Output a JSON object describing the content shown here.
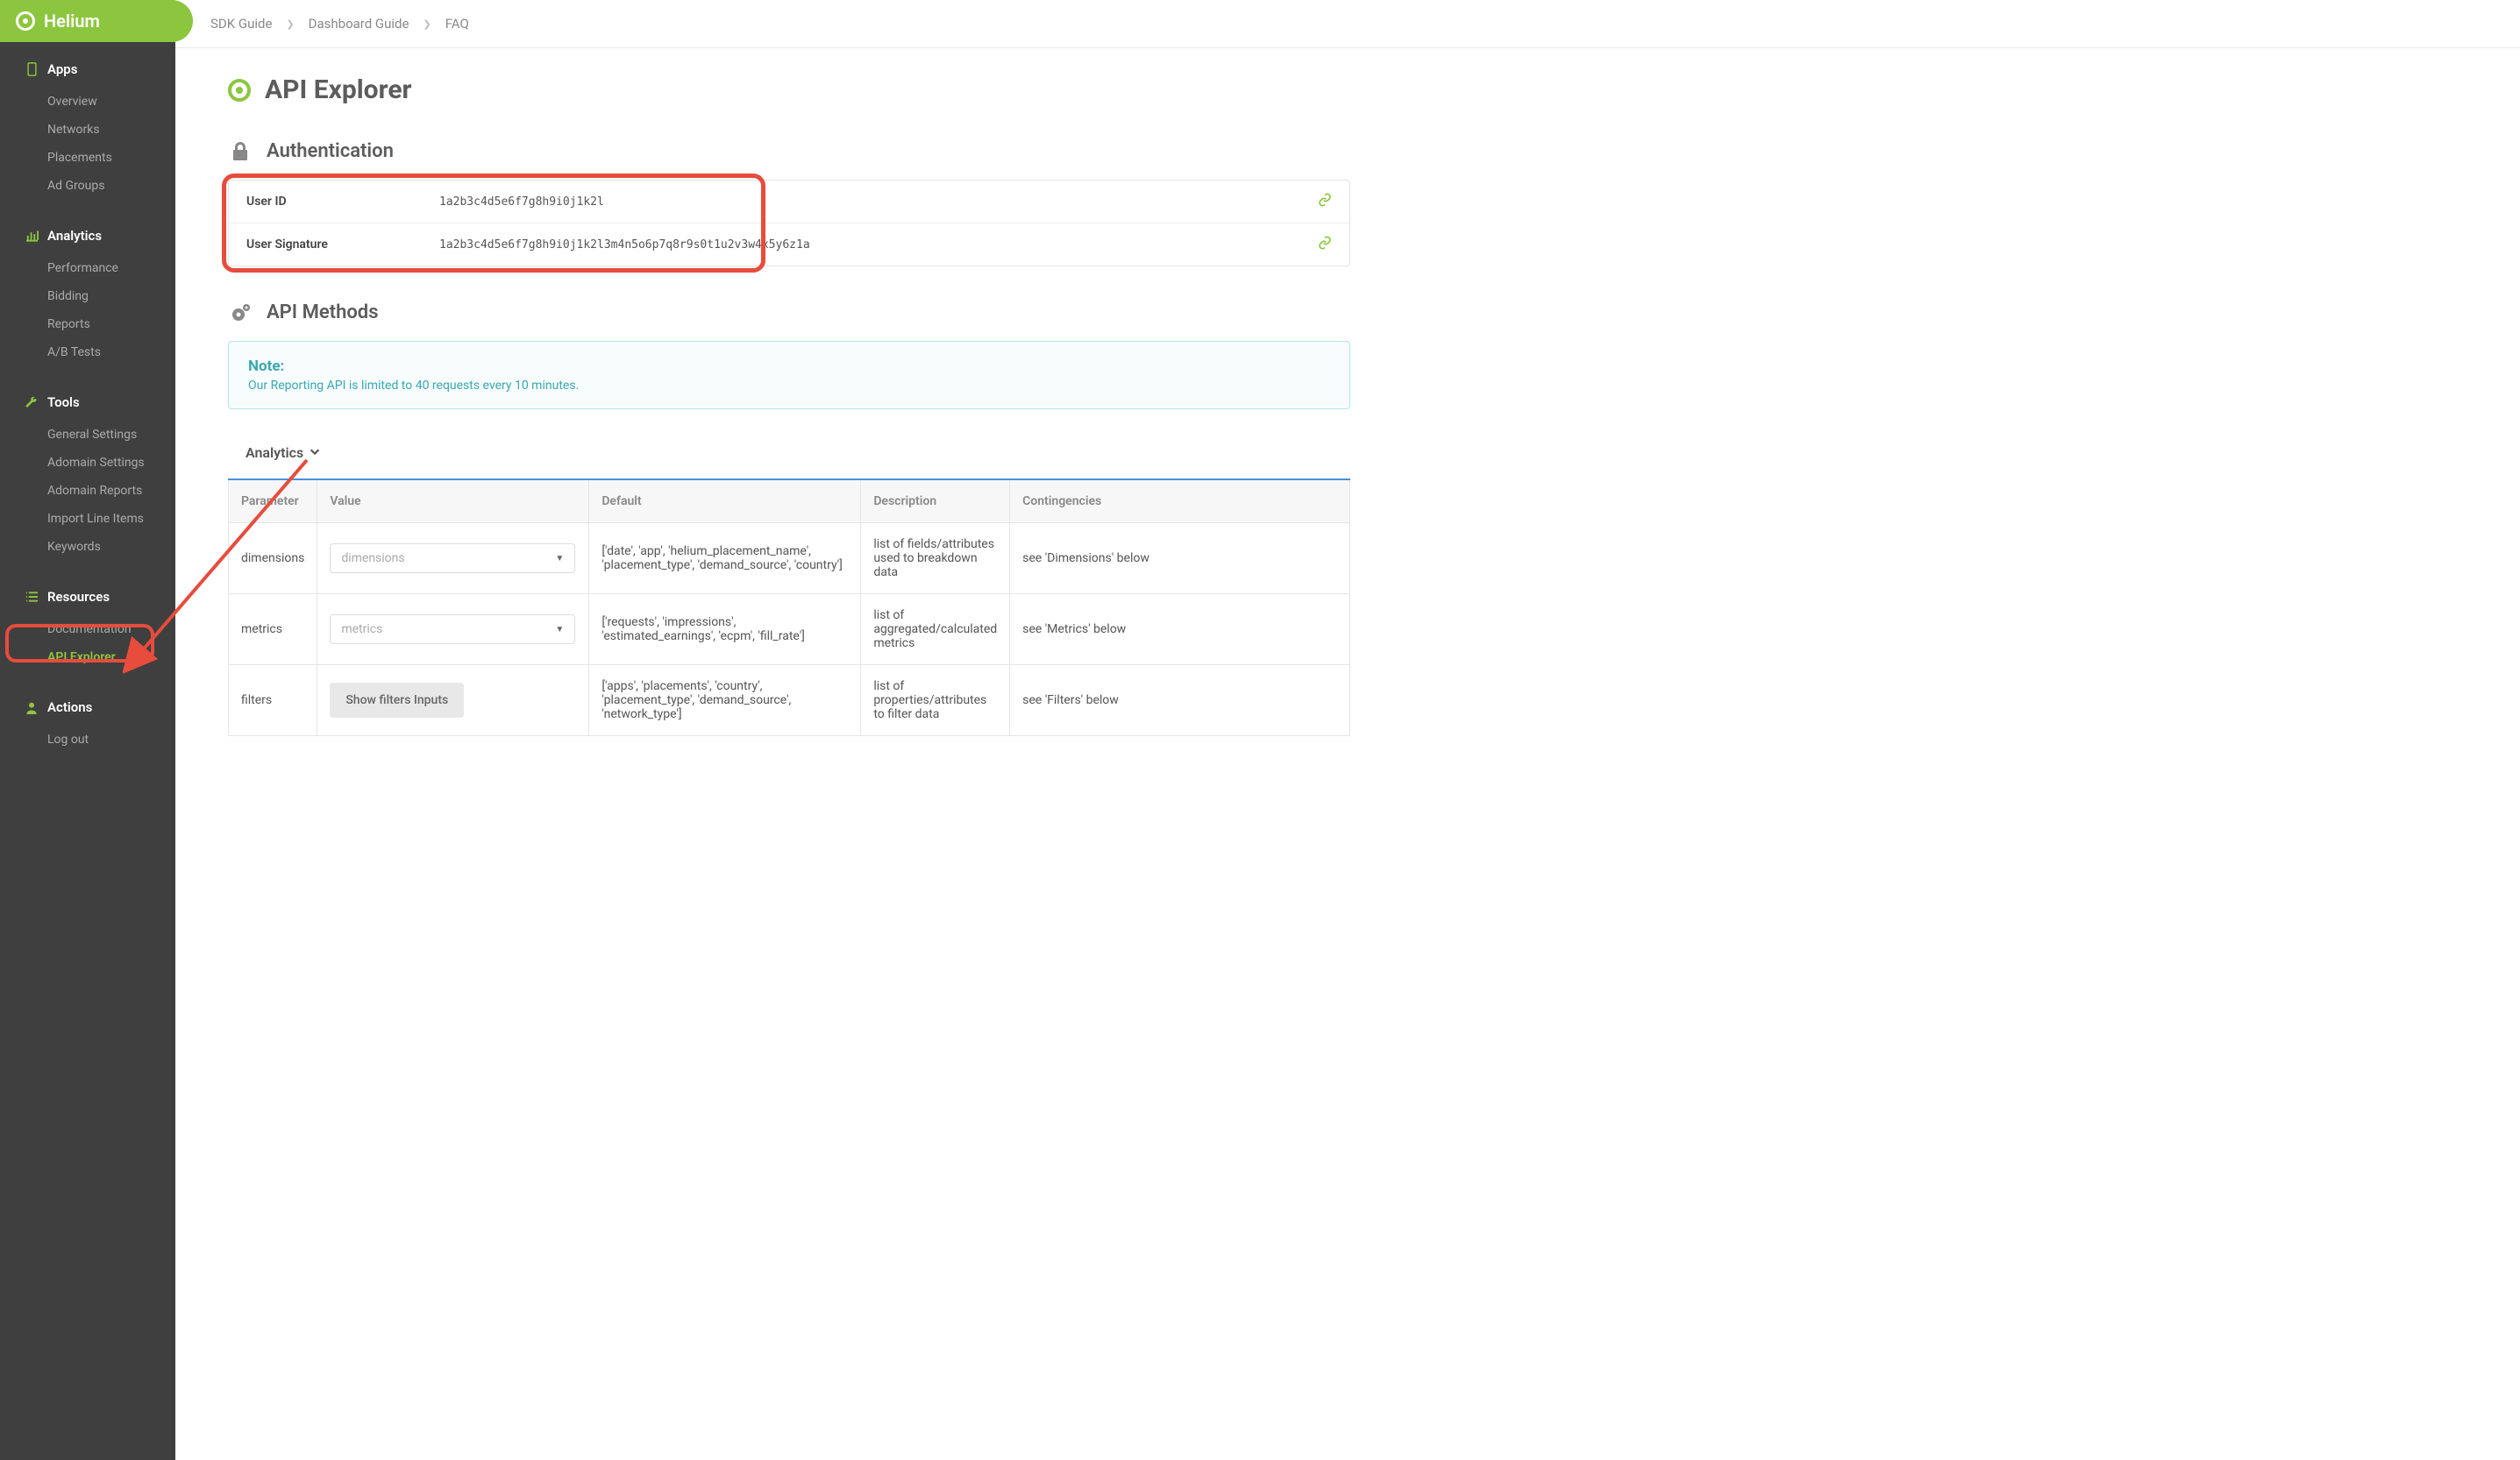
{
  "brand": "Helium",
  "topbar": {
    "sdk": "SDK Guide",
    "dashboard": "Dashboard Guide",
    "faq": "FAQ"
  },
  "sidebar": {
    "apps": {
      "label": "Apps",
      "items": [
        "Overview",
        "Networks",
        "Placements",
        "Ad Groups"
      ]
    },
    "analytics": {
      "label": "Analytics",
      "items": [
        "Performance",
        "Bidding",
        "Reports",
        "A/B Tests"
      ]
    },
    "tools": {
      "label": "Tools",
      "items": [
        "General Settings",
        "Adomain Settings",
        "Adomain Reports",
        "Import Line Items",
        "Keywords"
      ]
    },
    "resources": {
      "label": "Resources",
      "items": [
        "Documentation",
        "API Explorer"
      ]
    },
    "actions": {
      "label": "Actions",
      "items": [
        "Log out"
      ]
    }
  },
  "page": {
    "title": "API Explorer",
    "auth": {
      "heading": "Authentication",
      "user_id_label": "User ID",
      "user_id_value": "1a2b3c4d5e6f7g8h9i0j1k2l",
      "user_sig_label": "User Signature",
      "user_sig_value": "1a2b3c4d5e6f7g8h9i0j1k2l3m4n5o6p7q8r9s0t1u2v3w4x5y6z1a"
    },
    "methods": {
      "heading": "API Methods",
      "note_title": "Note:",
      "note_text": "Our Reporting API is limited to 40 requests every 10 minutes."
    },
    "analytics_label": "Analytics",
    "table": {
      "headers": {
        "parameter": "Parameter",
        "value": "Value",
        "default": "Default",
        "description": "Description",
        "contingencies": "Contingencies"
      },
      "rows": [
        {
          "param": "dimensions",
          "value_placeholder": "dimensions",
          "value_type": "dropdown",
          "default": "['date', 'app', 'helium_placement_name', 'placement_type', 'demand_source', 'country']",
          "description": "list of fields/attributes used to breakdown data",
          "contingencies": "see 'Dimensions' below"
        },
        {
          "param": "metrics",
          "value_placeholder": "metrics",
          "value_type": "dropdown",
          "default": "['requests', 'impressions', 'estimated_earnings', 'ecpm', 'fill_rate']",
          "description": "list of aggregated/calculated metrics",
          "contingencies": "see 'Metrics' below"
        },
        {
          "param": "filters",
          "value_button": "Show filters Inputs",
          "value_type": "button",
          "default": "['apps', 'placements', 'country', 'placement_type', 'demand_source', 'network_type']",
          "description": "list of properties/attributes to filter data",
          "contingencies": "see 'Filters' below"
        }
      ]
    }
  }
}
